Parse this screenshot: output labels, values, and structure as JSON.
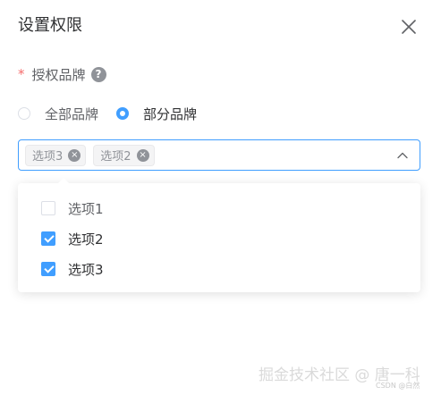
{
  "dialog": {
    "title": "设置权限",
    "close_icon": "close-icon"
  },
  "field": {
    "required_mark": "*",
    "label": "授权品牌",
    "help_icon": "question-circle-icon",
    "help_glyph": "?"
  },
  "radio": {
    "options": [
      {
        "label": "全部品牌",
        "checked": false
      },
      {
        "label": "部分品牌",
        "checked": true
      }
    ]
  },
  "select": {
    "tags": [
      "选项3",
      "选项2"
    ],
    "tag_close_glyph": "×",
    "arrow_icon": "chevron-up-icon"
  },
  "dropdown": {
    "options": [
      {
        "label": "选项1",
        "checked": false
      },
      {
        "label": "选项2",
        "checked": true
      },
      {
        "label": "选项3",
        "checked": true
      }
    ]
  },
  "watermark": {
    "main": "掘金技术社区 @ 唐一科",
    "sub": "CSDN @白然"
  },
  "colors": {
    "primary": "#409eff",
    "required": "#f56c6c",
    "text": "#303133",
    "secondary_text": "#606266",
    "tag_bg": "#f4f4f5"
  }
}
